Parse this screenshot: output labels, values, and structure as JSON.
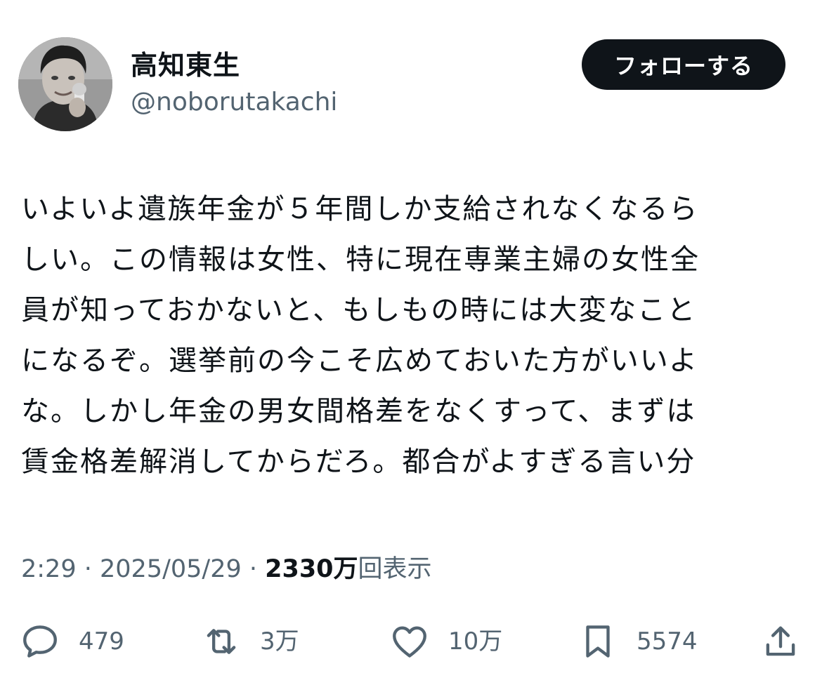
{
  "author": {
    "display_name": "高知東生",
    "handle": "@noborutakachi"
  },
  "follow_button": {
    "label": "フォローする"
  },
  "tweet": {
    "lines": [
      "いよいよ遺族年金が５年間しか支給されなくなるら",
      "しい。この情報は女性、特に現在専業主婦の女性全",
      "員が知っておかないと、もしもの時には大変なこと",
      "になるぞ。選挙前の今こそ広めておいた方がいいよ",
      "な。しかし年金の男女間格差をなくすって、まずは",
      "賃金格差解消してからだろ。都合がよすぎる言い分"
    ]
  },
  "meta": {
    "time": "2:29",
    "separator": " · ",
    "date": "2025/05/29",
    "views_count": "2330万",
    "views_label": "回表示"
  },
  "actions": {
    "reply": {
      "icon": "reply-icon",
      "count": "479"
    },
    "retweet": {
      "icon": "retweet-icon",
      "count": "3万"
    },
    "like": {
      "icon": "heart-icon",
      "count": "10万"
    },
    "bookmark": {
      "icon": "bookmark-icon",
      "count": "5574"
    },
    "share": {
      "icon": "share-icon"
    }
  },
  "colors": {
    "text_primary": "#0f1419",
    "text_secondary": "#536471",
    "follow_button_bg": "#0f1419",
    "follow_button_text": "#ffffff",
    "background": "#ffffff"
  }
}
